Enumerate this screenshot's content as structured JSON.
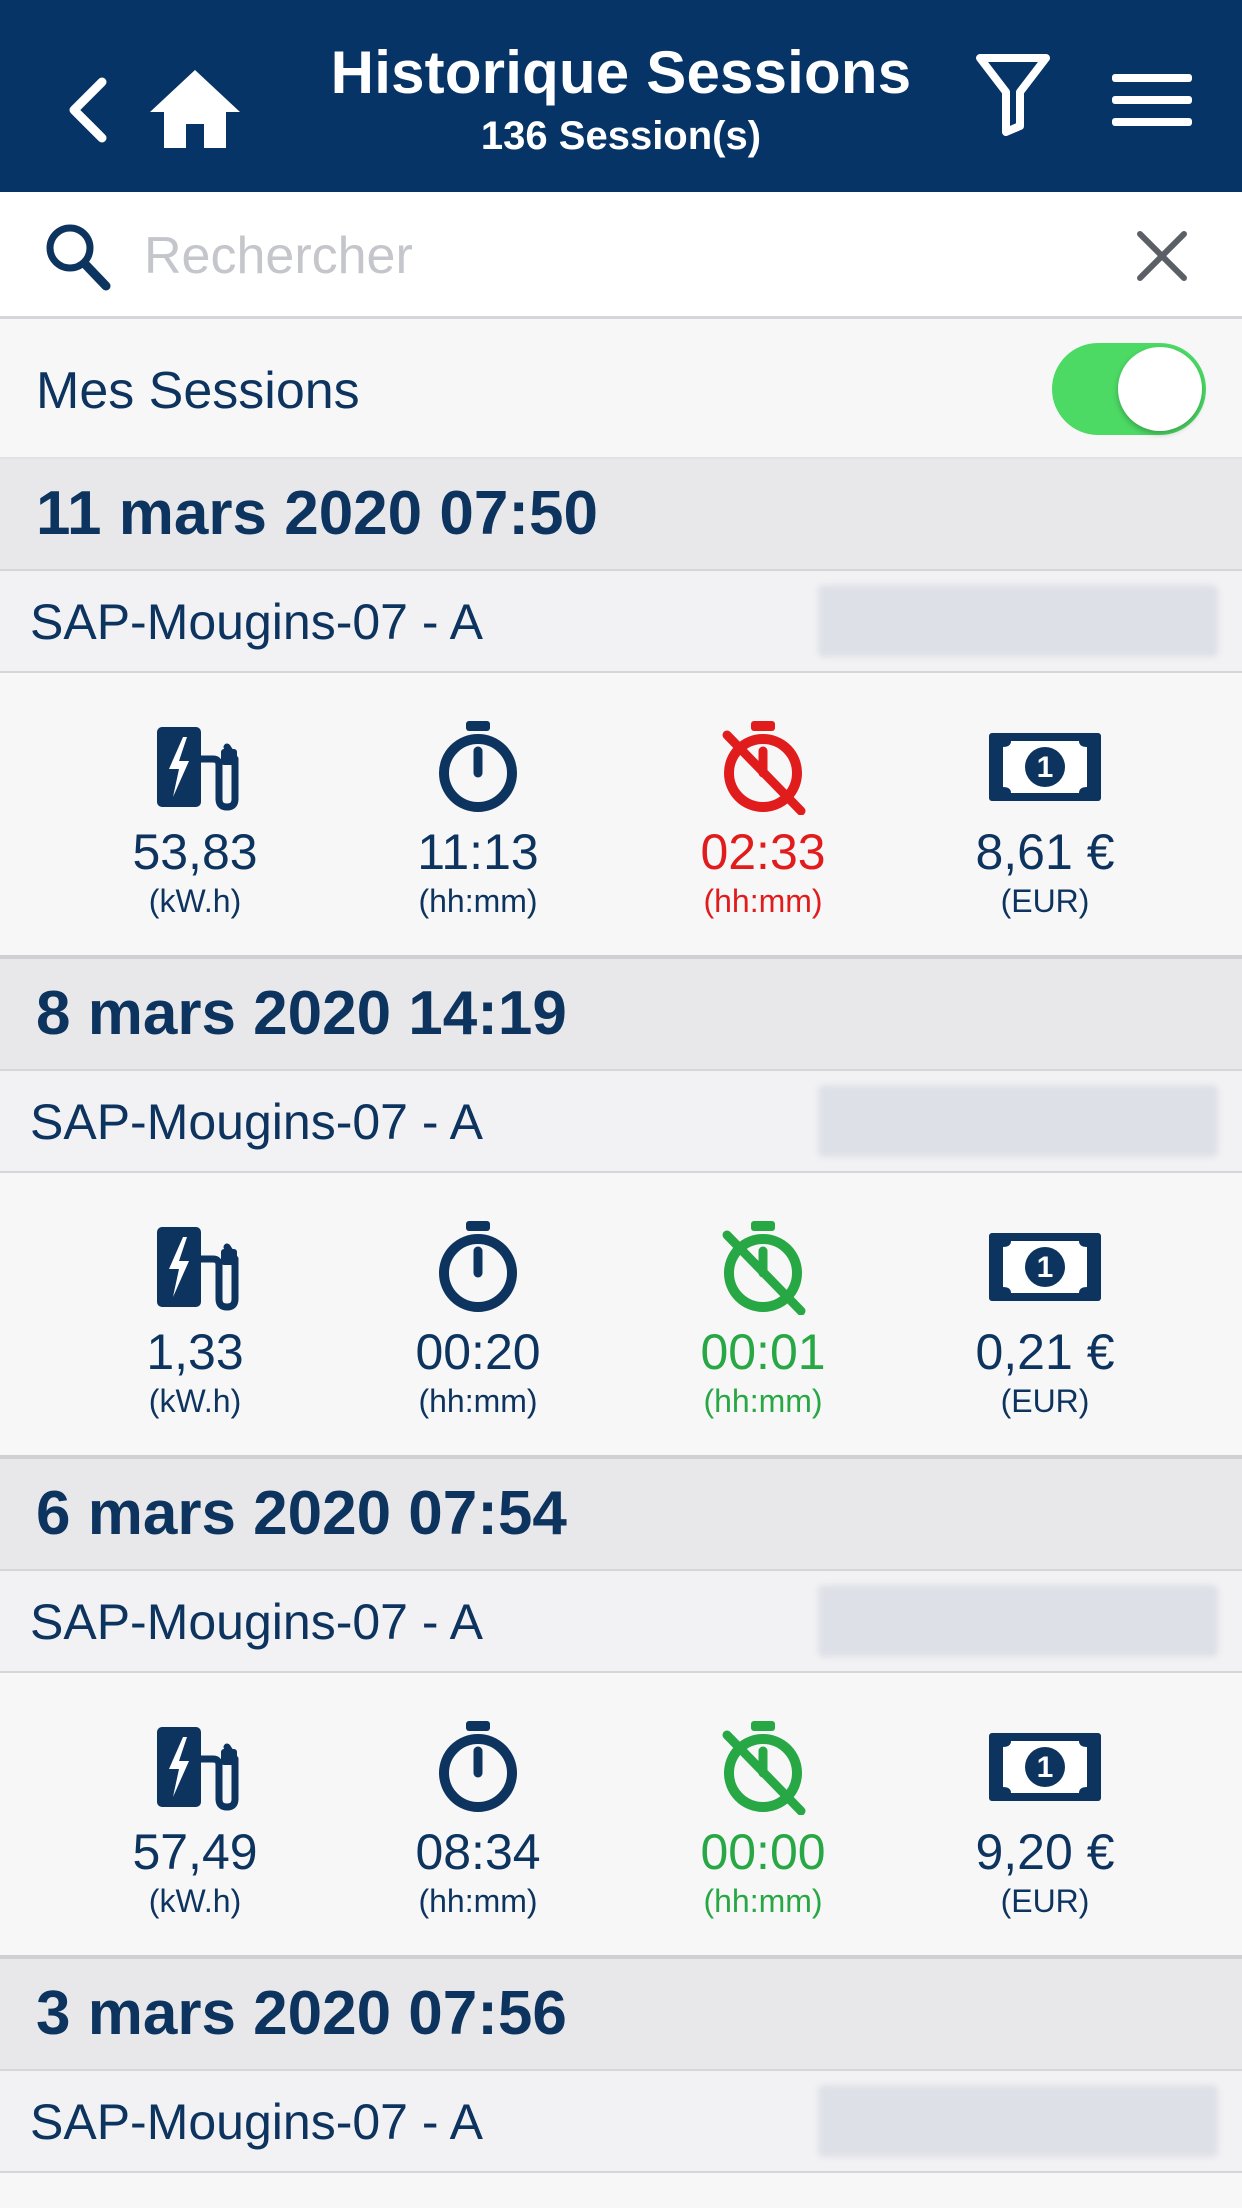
{
  "header": {
    "title": "Historique Sessions",
    "subtitle": "136 Session(s)"
  },
  "search": {
    "placeholder": "Rechercher"
  },
  "toggle": {
    "label": "Mes Sessions",
    "on": true
  },
  "colors": {
    "nav": "#073466",
    "text": "#0d335f",
    "alert": "#e11c1c",
    "ok": "#28a745",
    "toggle_on": "#4cd964"
  },
  "sessions": [
    {
      "date": "11 mars 2020 07:50",
      "station": "SAP-Mougins-07 - A",
      "energy": {
        "value": "53,83",
        "unit": "(kW.h)"
      },
      "duration": {
        "value": "11:13",
        "unit": "(hh:mm)"
      },
      "idle": {
        "value": "02:33",
        "unit": "(hh:mm)",
        "status": "alert"
      },
      "cost": {
        "value": "8,61 €",
        "unit": "(EUR)"
      }
    },
    {
      "date": "8 mars 2020 14:19",
      "station": "SAP-Mougins-07 - A",
      "energy": {
        "value": "1,33",
        "unit": "(kW.h)"
      },
      "duration": {
        "value": "00:20",
        "unit": "(hh:mm)"
      },
      "idle": {
        "value": "00:01",
        "unit": "(hh:mm)",
        "status": "ok"
      },
      "cost": {
        "value": "0,21 €",
        "unit": "(EUR)"
      }
    },
    {
      "date": "6 mars 2020 07:54",
      "station": "SAP-Mougins-07 - A",
      "energy": {
        "value": "57,49",
        "unit": "(kW.h)"
      },
      "duration": {
        "value": "08:34",
        "unit": "(hh:mm)"
      },
      "idle": {
        "value": "00:00",
        "unit": "(hh:mm)",
        "status": "ok"
      },
      "cost": {
        "value": "9,20 €",
        "unit": "(EUR)"
      }
    },
    {
      "date": "3 mars 2020 07:56",
      "station": "SAP-Mougins-07 - A"
    }
  ]
}
